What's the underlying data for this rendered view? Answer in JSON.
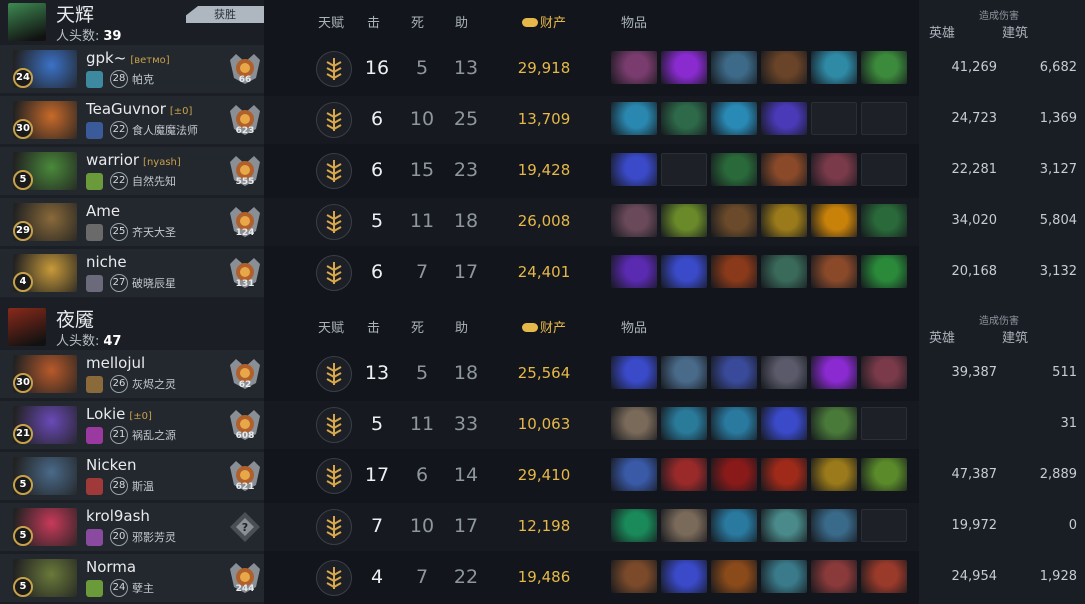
{
  "headers": {
    "talent": "天赋",
    "kills": "击",
    "deaths": "死",
    "assists": "助",
    "networth": "财产",
    "items": "物品",
    "damage_caption": "造成伤害",
    "hero_damage": "英雄",
    "building_damage": "建筑"
  },
  "teams": [
    {
      "name": "天辉",
      "kills_label": "人头数:",
      "kills": "39",
      "win_label": "获胜",
      "logo_color": "#3e8a52",
      "players": [
        {
          "name": "gpk~",
          "tag": "[ветмо]",
          "hero": "帕克",
          "hero_level": "24",
          "account_level": "28",
          "rank": "66",
          "k": "16",
          "d": "5",
          "a": "13",
          "nw": "29,918",
          "hero_dmg": "41,269",
          "bld_dmg": "6,682",
          "portrait": "#3b72c8",
          "badge": "#3d8aa0",
          "items": [
            "#7a3c6e",
            "#8a2bd0",
            "#3d6a88",
            "#6a4428",
            "#2f8aa6",
            "#3c8a3c"
          ]
        },
        {
          "name": "TeaGuvnor",
          "tag": "[±0]",
          "hero": "食人魔魔法师",
          "hero_level": "30",
          "account_level": "22",
          "rank": "623",
          "k": "6",
          "d": "10",
          "a": "25",
          "nw": "13,709",
          "hero_dmg": "24,723",
          "bld_dmg": "1,369",
          "portrait": "#c86a2a",
          "badge": "#3a5a9a",
          "items": [
            "#2a88b0",
            "#2e6a4a",
            "#2a8ab6",
            "#4a3ab8",
            "",
            ""
          ]
        },
        {
          "name": "warrior",
          "tag": "[nyash]",
          "hero": "自然先知",
          "hero_level": "5",
          "account_level": "22",
          "rank": "555",
          "k": "6",
          "d": "15",
          "a": "23",
          "nw": "19,428",
          "hero_dmg": "22,281",
          "bld_dmg": "3,127",
          "portrait": "#4a8a3a",
          "badge": "#6a9a3a",
          "items": [
            "#3a4ac8",
            "",
            "#2a6a3a",
            "#8a4a2a",
            "#7a3a4a",
            ""
          ]
        },
        {
          "name": "Ame",
          "tag": "",
          "hero": "齐天大圣",
          "hero_level": "29",
          "account_level": "25",
          "rank": "124",
          "k": "5",
          "d": "11",
          "a": "18",
          "nw": "26,008",
          "hero_dmg": "34,020",
          "bld_dmg": "5,804",
          "portrait": "#8a6a3a",
          "badge": "#6a6a6a",
          "items": [
            "#6a4a5a",
            "#6a8a2a",
            "#6a4a2a",
            "#9a7a1a",
            "#c8820a",
            "#2a6a3a"
          ]
        },
        {
          "name": "niche",
          "tag": "",
          "hero": "破晓辰星",
          "hero_level": "4",
          "account_level": "27",
          "rank": "131",
          "k": "6",
          "d": "7",
          "a": "17",
          "nw": "24,401",
          "hero_dmg": "20,168",
          "bld_dmg": "3,132",
          "portrait": "#c89a3a",
          "badge": "#6a6a7a",
          "items": [
            "#5a2ab0",
            "#3a4ac8",
            "#8a3a1a",
            "#3a6a5a",
            "#8a4a2a",
            "#2a8a3a"
          ]
        }
      ]
    },
    {
      "name": "夜魇",
      "kills_label": "人头数:",
      "kills": "47",
      "logo_color": "#8a2a1a",
      "players": [
        {
          "name": "mellojul",
          "tag": "",
          "hero": "灰烬之灵",
          "hero_level": "30",
          "account_level": "26",
          "rank": "62",
          "k": "13",
          "d": "5",
          "a": "18",
          "nw": "25,564",
          "hero_dmg": "39,387",
          "bld_dmg": "511",
          "portrait": "#b85a2a",
          "badge": "#8a6a3a",
          "items": [
            "#3a4ac8",
            "#4a6a8a",
            "#3a4a9a",
            "#5a5a6a",
            "#8a2ad0",
            "#7a3a4a"
          ]
        },
        {
          "name": "Lokie",
          "tag": "[±0]",
          "hero": "祸乱之源",
          "hero_level": "21",
          "account_level": "21",
          "rank": "608",
          "k": "5",
          "d": "11",
          "a": "33",
          "nw": "10,063",
          "hero_dmg": "",
          "bld_dmg": "31",
          "portrait": "#6a4ab8",
          "badge": "#9a3aa0",
          "items": [
            "#7a6a5a",
            "#2a7a9a",
            "#2a7aa0",
            "#3a4ac8",
            "#4a7a3a",
            ""
          ]
        },
        {
          "name": "Nicken",
          "tag": "",
          "hero": "斯温",
          "hero_level": "5",
          "account_level": "28",
          "rank": "621",
          "k": "17",
          "d": "6",
          "a": "14",
          "nw": "29,410",
          "hero_dmg": "47,387",
          "bld_dmg": "2,889",
          "portrait": "#4a6a8a",
          "badge": "#a03a3a",
          "items": [
            "#3a5aa8",
            "#9a2a2a",
            "#8a1a1a",
            "#a02a1a",
            "#9a7a1a",
            "#5a8a2a"
          ]
        },
        {
          "name": "krol9ash",
          "tag": "",
          "hero": "邪影芳灵",
          "hero_level": "5",
          "account_level": "20",
          "rank": "",
          "k": "7",
          "d": "10",
          "a": "17",
          "nw": "12,198",
          "hero_dmg": "19,972",
          "bld_dmg": "0",
          "portrait": "#c83a5a",
          "badge": "#8a4aa0",
          "items": [
            "#1a8a5a",
            "#7a6a5a",
            "#2a7aa0",
            "#4a8a8a",
            "#3a6a8a",
            ""
          ]
        },
        {
          "name": "Norma",
          "tag": "",
          "hero": "孽主",
          "hero_level": "5",
          "account_level": "24",
          "rank": "244",
          "k": "4",
          "d": "7",
          "a": "22",
          "nw": "19,486",
          "hero_dmg": "24,954",
          "bld_dmg": "1,928",
          "portrait": "#6a7a3a",
          "badge": "#6a9a3a",
          "items": [
            "#7a4a2a",
            "#3a4ac8",
            "#8a4a1a",
            "#3a7a8a",
            "#8a3a3a",
            "#9a3a2a"
          ]
        }
      ]
    }
  ]
}
